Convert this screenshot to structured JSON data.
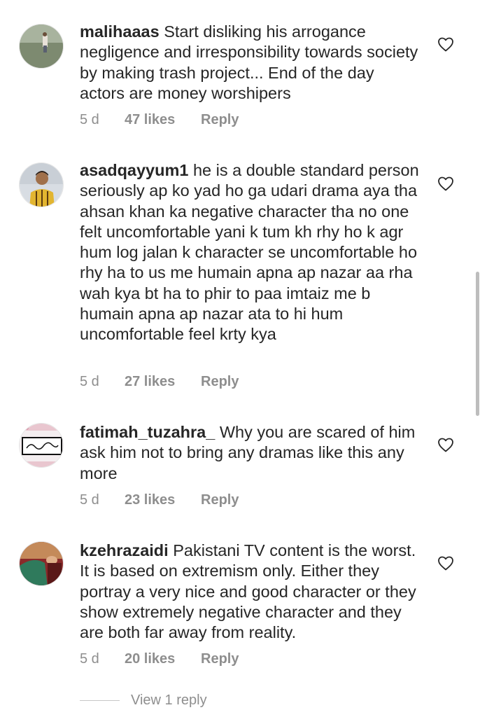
{
  "comments": [
    {
      "username": "malihaaas",
      "text": "Start disliking his arrogance negligence and irresponsibility towards society by making trash project... End of the day actors are money worshipers",
      "time": "5 d",
      "likes": "47 likes",
      "reply": "Reply",
      "avatar_icon": "avatar-photo-outdoor"
    },
    {
      "username": "asadqayyum1",
      "text": "he is a double standard person seriously ap ko yad ho ga udari drama aya tha ahsan khan ka negative character tha no one felt uncomfortable yani k tum kh rhy ho k agr hum log jalan k character se uncomfortable ho rhy ha to us me humain apna ap nazar aa rha wah kya bt ha to phir to paa imtaiz me b humain apna ap nazar ata to hi hum uncomfortable feel krty kya",
      "time": "5 d",
      "likes": "27 likes",
      "reply": "Reply",
      "avatar_icon": "avatar-photo-person"
    },
    {
      "username": "fatimah_tuzahra_",
      "text": "Why you are scared of him ask him not to bring any dramas like this any more",
      "time": "5 d",
      "likes": "23 likes",
      "reply": "Reply",
      "avatar_icon": "avatar-calligraphy"
    },
    {
      "username": "kzehrazaidi",
      "text": "Pakistani TV content is the worst. It is based on extremism only. Either they portray a very  nice and good character or they show extremely negative character and they are both far away from reality.",
      "time": "5 d",
      "likes": "20 likes",
      "reply": "Reply",
      "avatar_icon": "avatar-photo-hands"
    }
  ],
  "view_replies": "View 1 reply",
  "colors": {
    "text": "#262626",
    "meta": "#8e8e8e",
    "divider": "#c7c7c7",
    "scrollbar": "#bdbdbd"
  }
}
